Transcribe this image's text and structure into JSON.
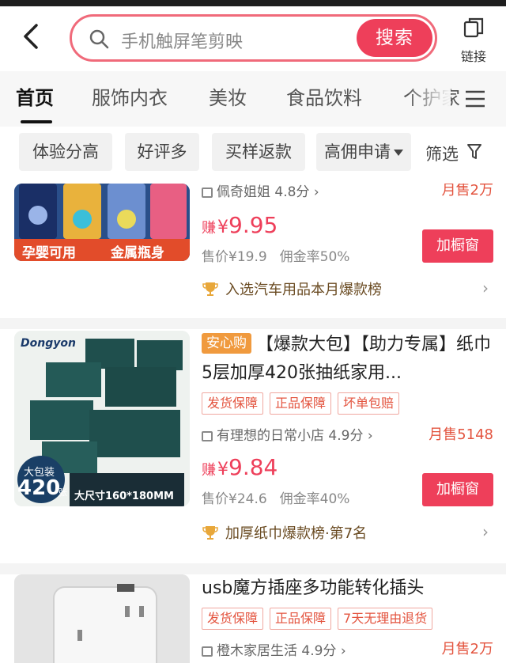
{
  "header": {
    "search_placeholder": "手机触屏笔剪映",
    "search_button": "搜索",
    "link_label": "链接"
  },
  "tabs": [
    "首页",
    "服饰内衣",
    "美妆",
    "食品饮料",
    "个护家"
  ],
  "filters": [
    "体验分高",
    "好评多",
    "买样返款",
    "高佣申请",
    "筛选"
  ],
  "products": [
    {
      "image_text": [
        "孕婴可用",
        "金属瓶身"
      ],
      "shop": "佩奇姐姐 4.8分 ›",
      "sales": "月售2万",
      "price_prefix": "赚",
      "price_currency": "¥",
      "price": "9.95",
      "orig_price": "售价¥19.9",
      "commission": "佣金率50%",
      "add_button": "加橱窗",
      "rank": "入选汽车用品本月爆款榜"
    },
    {
      "badge": "安心购",
      "title": "【爆款大包】【助力专属】纸巾5层加厚420张抽纸家用...",
      "tags": [
        "发货保障",
        "正品保障",
        "坏单包赔"
      ],
      "shop": "有理想的日常小店 4.9分 ›",
      "sales": "月售5148",
      "price_prefix": "赚",
      "price_currency": "¥",
      "price": "9.84",
      "orig_price": "售价¥24.6",
      "commission": "佣金率40%",
      "add_button": "加橱窗",
      "rank": "加厚纸巾爆款榜·第7名",
      "image_text": [
        "Dongyon",
        "大包装",
        "420",
        "张",
        "大尺寸160*180MM"
      ]
    },
    {
      "title": "usb魔方插座多功能转化插头",
      "tags": [
        "发货保障",
        "正品保障",
        "7天无理由退货"
      ],
      "shop": "橙木家居生活 4.9分 ›",
      "sales": "月售2万"
    }
  ],
  "colors": {
    "accent": "#ee3f5a",
    "badge": "#f09a3e",
    "tag_text": "#e3543f"
  }
}
